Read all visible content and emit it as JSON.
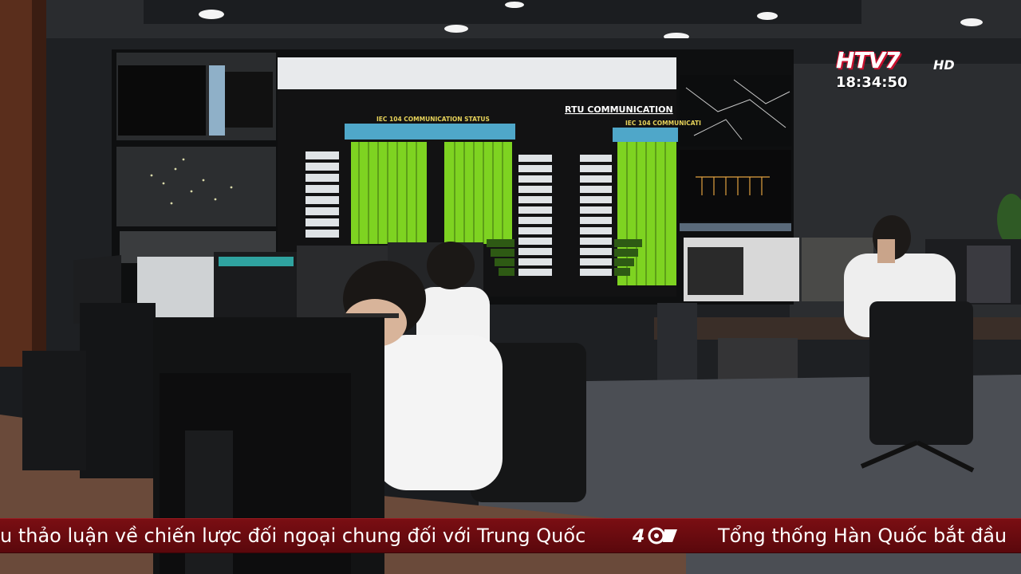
{
  "broadcast": {
    "channel_logo": "HTV7",
    "channel_hd": "HD",
    "clock": "18:34:50"
  },
  "ticker": {
    "left_text": "u thảo luận về chiến lược đối ngoại chung đối với Trung Quốc",
    "right_text": "Tổng thống Hàn Quốc bắt đầu",
    "badge_icon": "anniversary-badge-icon"
  },
  "video_wall": {
    "status_title": "IEC 104 COMMUNICATION STATUS",
    "rtu_title": "RTU COMMUNICATION",
    "status_title_right": "IEC 104 COMMUNICATI"
  },
  "colors": {
    "ticker_red": "#6e0b10",
    "logo_red": "#c8102e",
    "status_green": "#7ed321",
    "wall_dark": "#151515"
  }
}
